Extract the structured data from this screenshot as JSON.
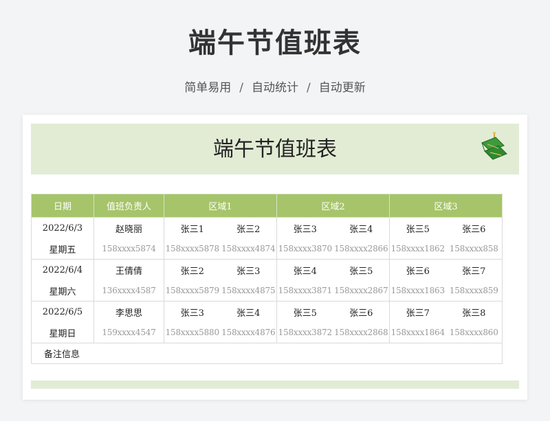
{
  "page": {
    "title": "端午节值班表",
    "subtitle_parts": [
      "简单易用",
      "自动统计",
      "自动更新"
    ],
    "separator": "/"
  },
  "sheet": {
    "title": "端午节值班表",
    "headers": [
      "日期",
      "值班负责人",
      "区域1",
      "区域2",
      "区域3"
    ],
    "rows": [
      {
        "date": "2022/6/3",
        "weekday": "星期五",
        "lead": "赵晓丽",
        "lead_phone": "158xxxx5874",
        "staff": [
          "张三1",
          "张三2",
          "张三3",
          "张三4",
          "张三5",
          "张三6"
        ],
        "phones": [
          "158xxxx5878",
          "158xxxx4874",
          "158xxxx3870",
          "158xxxx2866",
          "158xxxx1862",
          "158xxxx858"
        ]
      },
      {
        "date": "2022/6/4",
        "weekday": "星期六",
        "lead": "王倩倩",
        "lead_phone": "136xxxx4587",
        "staff": [
          "张三2",
          "张三3",
          "张三4",
          "张三5",
          "张三6",
          "张三7"
        ],
        "phones": [
          "158xxxx5879",
          "158xxxx4875",
          "158xxxx3871",
          "158xxxx2867",
          "158xxxx1863",
          "158xxxx859"
        ]
      },
      {
        "date": "2022/6/5",
        "weekday": "星期日",
        "lead": "李思思",
        "lead_phone": "159xxxx4547",
        "staff": [
          "张三3",
          "张三4",
          "张三5",
          "张三6",
          "张三7",
          "张三8"
        ],
        "phones": [
          "158xxxx5880",
          "158xxxx4876",
          "158xxxx3872",
          "158xxxx2868",
          "158xxxx1864",
          "158xxxx860"
        ]
      }
    ],
    "notes_label": "备注信息"
  },
  "colors": {
    "header_green": "#a6c46a",
    "banner_green": "#e2ecd5",
    "phone_gray": "#999999"
  },
  "icons": {
    "decoration": "zongzi-icon"
  }
}
